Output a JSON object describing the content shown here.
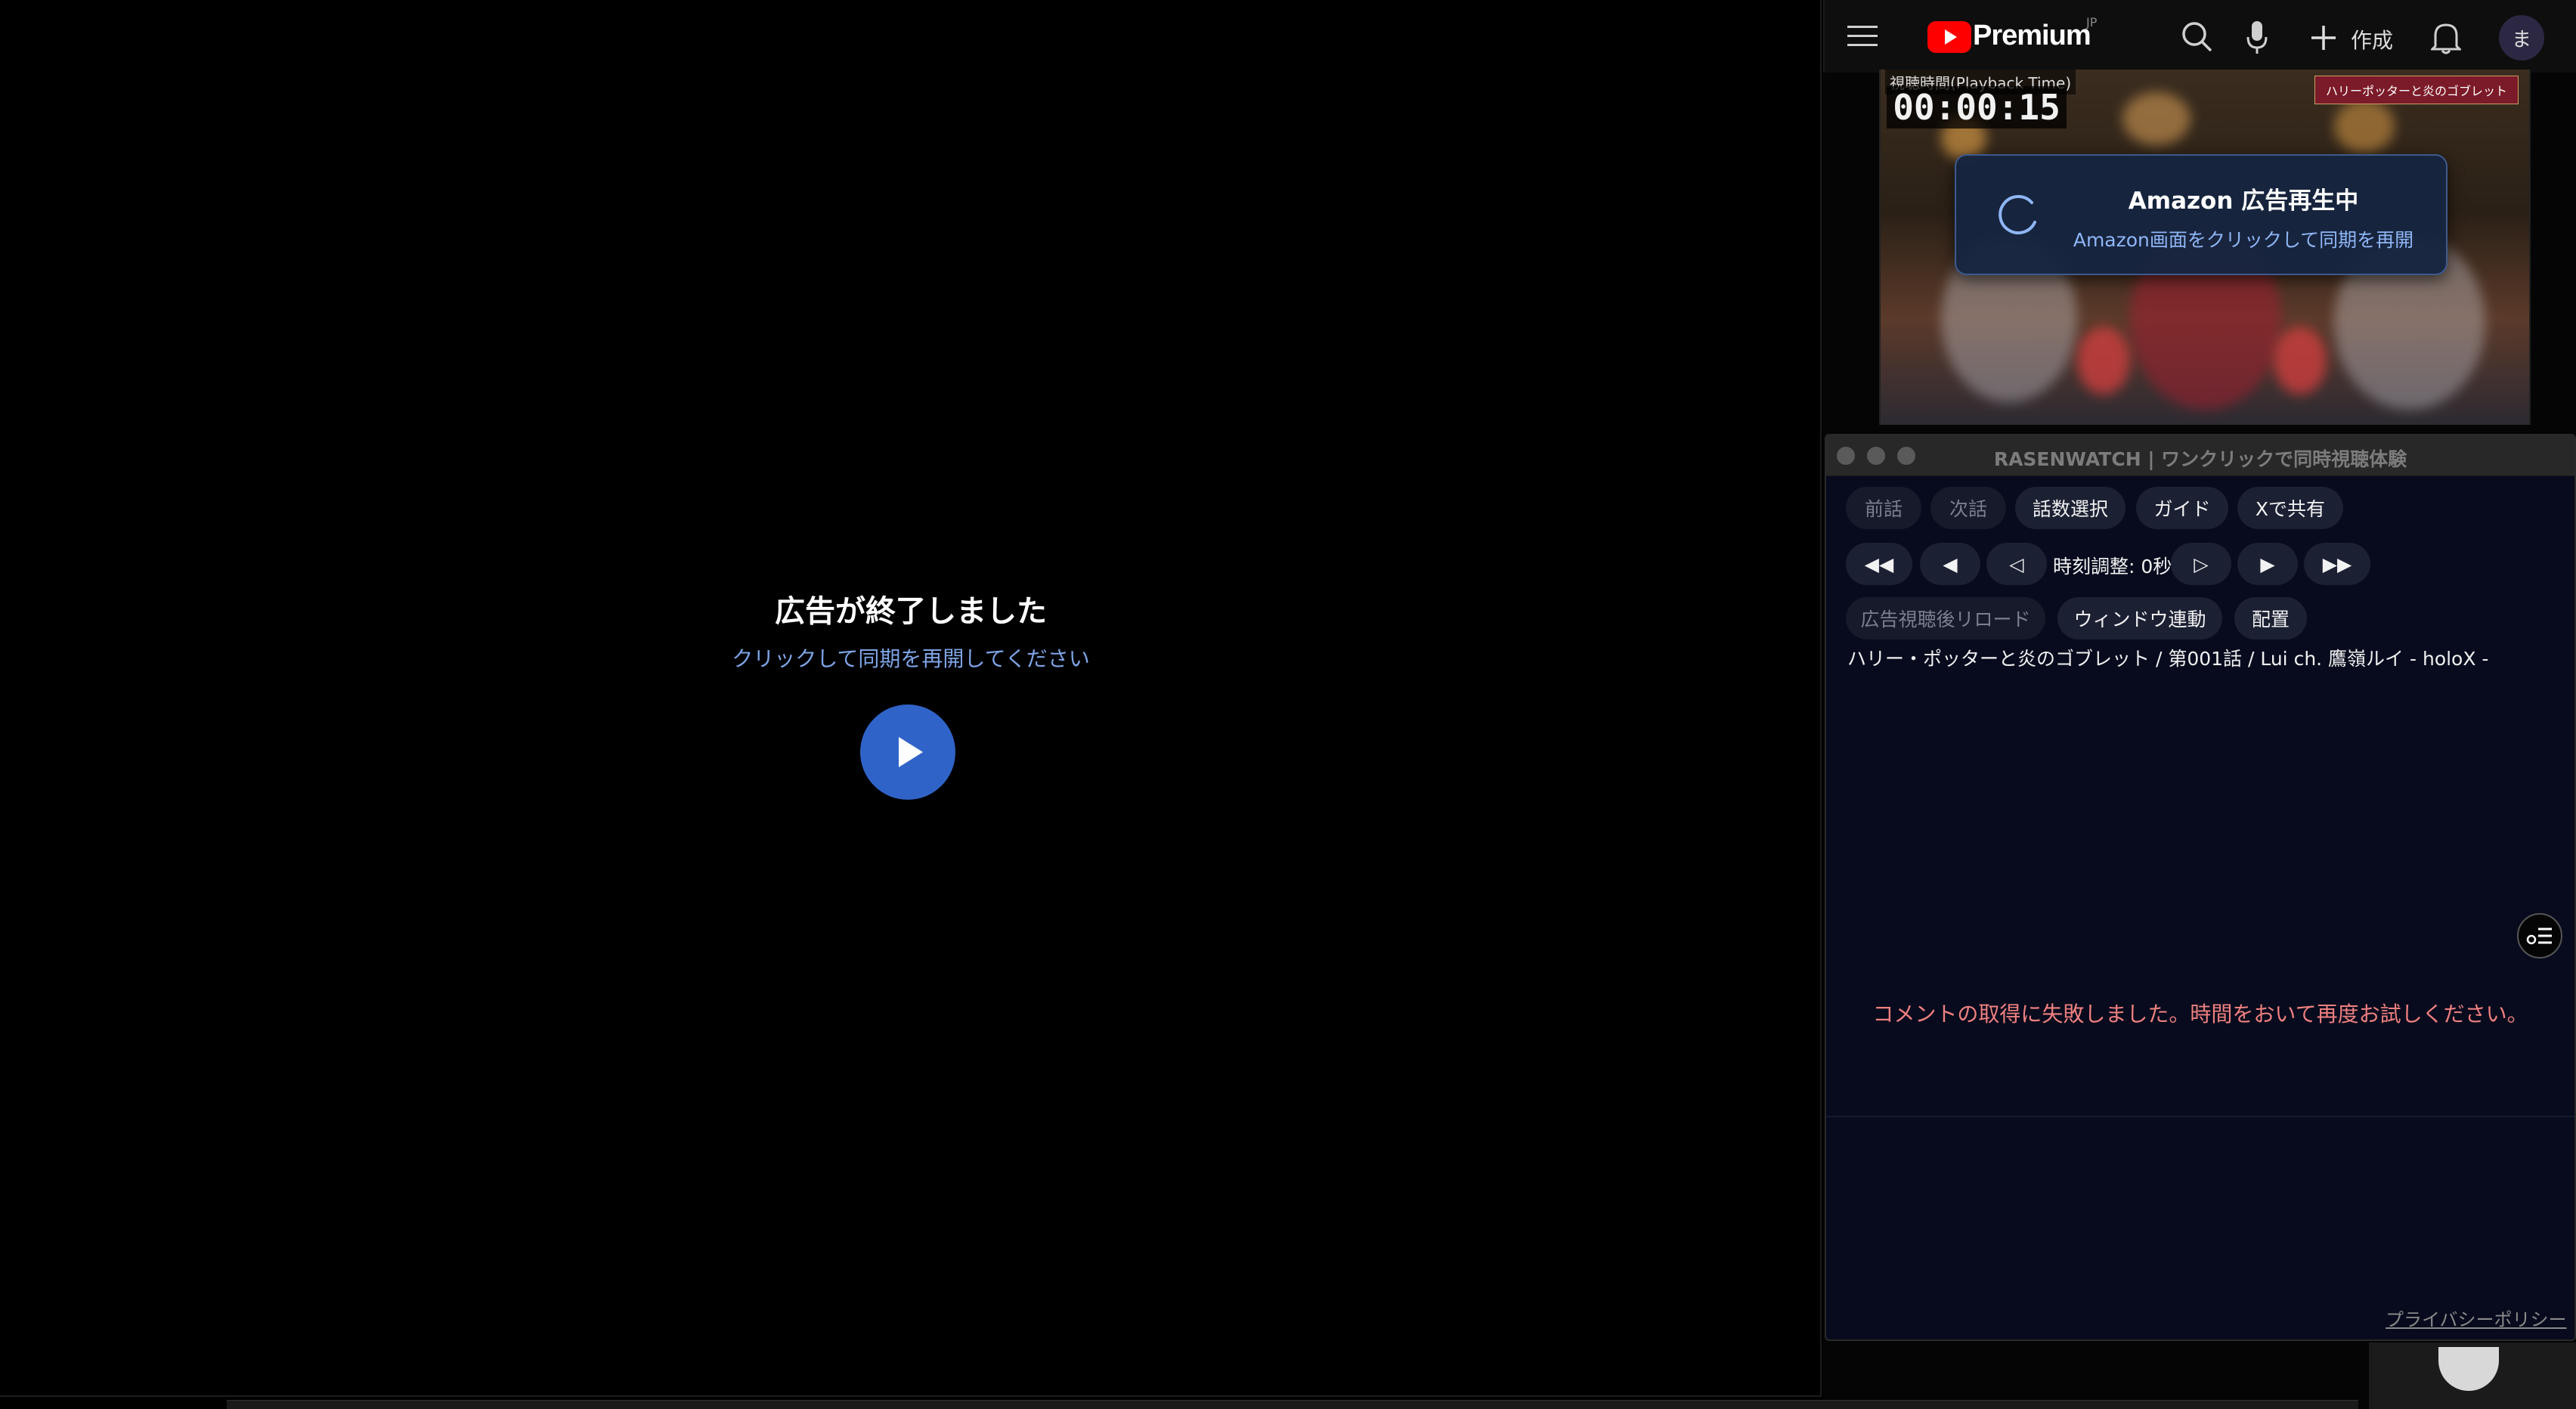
{
  "left_player": {
    "title": "広告が終了しました",
    "subtitle": "クリックして同期を再開してください"
  },
  "youtube_header": {
    "logo_text": "Premium",
    "region": "JP",
    "create_label": "作成",
    "avatar_initial": "ま"
  },
  "mini_video": {
    "playback_label": "視聴時間(Playback Time)",
    "playback_time": "00:00:15",
    "title_banner": "ハリーポッターと炎のゴブレット"
  },
  "amazon_card": {
    "title": "Amazon 広告再生中",
    "subtitle": "Amazon画面をクリックして同期を再開"
  },
  "rasenwatch": {
    "window_title": "RASENWATCH | ワンクリックで同時視聴体験",
    "buttons_row1": {
      "prev_episode": "前話",
      "next_episode": "次話",
      "episode_select": "話数選択",
      "guide": "ガイド",
      "share_x": "Xで共有"
    },
    "buttons_row2": {
      "rewind_big": "◀◀",
      "rewind": "◀",
      "rewind_small": "◁",
      "offset_label": "時刻調整: 0秒",
      "forward_small": "▷",
      "forward": "▶",
      "forward_big": "▶▶"
    },
    "buttons_row3": {
      "reload_after_ad": "広告視聴後リロード",
      "window_link": "ウィンドウ連動",
      "layout": "配置"
    },
    "episode_info": "ハリー・ポッターと炎のゴブレット / 第001話 / Lui ch. 鷹嶺ルイ - holoX -",
    "comment_error": "コメントの取得に失敗しました。時間をおいて再度お試しください。",
    "privacy_link": "プライバシーポリシー"
  },
  "colors": {
    "accent_blue": "#2f63c8",
    "link_blue": "#7ea4e6",
    "error_red": "#f08080",
    "youtube_red": "#ff0000"
  }
}
